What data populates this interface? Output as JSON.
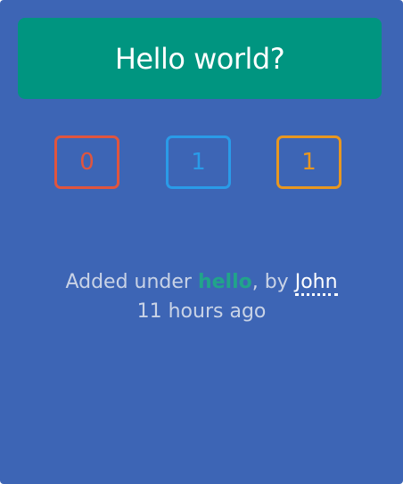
{
  "post": {
    "title": "Hello world?"
  },
  "counters": [
    {
      "value": "0",
      "color": "#e0553e"
    },
    {
      "value": "1",
      "color": "#2a9be8"
    },
    {
      "value": "1",
      "color": "#e89720"
    }
  ],
  "meta": {
    "prefix": "Added under ",
    "category": "hello",
    "by_text": ", by ",
    "author": "John",
    "time_ago": "11 hours ago"
  },
  "colors": {
    "card_background": "#3d65b5",
    "title_banner": "#009580",
    "category_link": "#21a48a"
  }
}
